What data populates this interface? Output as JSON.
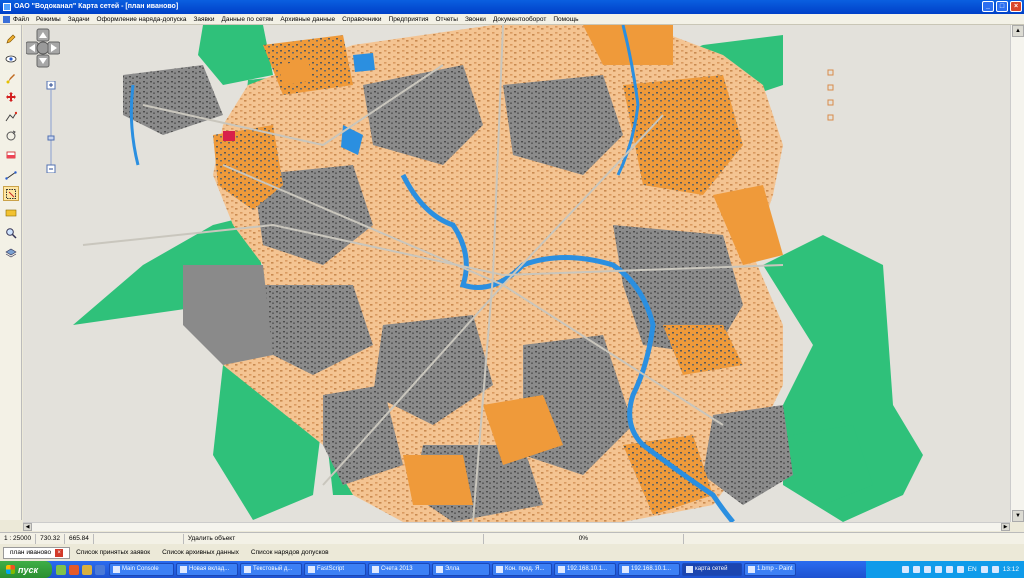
{
  "window": {
    "title": "ОАО \"Водоканал\" Карта сетей - [план иваново]"
  },
  "menu": [
    "Файл",
    "Режимы",
    "Задачи",
    "Оформление наряда-допуска",
    "Заявки",
    "Данные по сетям",
    "Архивные данные",
    "Справочники",
    "Предприятия",
    "Отчеты",
    "Звонки",
    "Документооборот",
    "Помощь"
  ],
  "status": {
    "scale": "1 : 25000",
    "x": "730.32",
    "y": "665.84",
    "message": "Удалить объект",
    "progress": "0%"
  },
  "bottom_tabs": {
    "active": "план иваново",
    "items": [
      "Список принятых заявок",
      "Список архивных данных",
      "Список нарядов допусков"
    ]
  },
  "taskbar": {
    "start": "пуск",
    "tasks": [
      "Main Console",
      "Новая вклад...",
      "Текстовый д...",
      "FastScript",
      "Счета 2013",
      "Элла",
      "Кон. пред. Я...",
      "192.168.10.1...",
      "192.168.10.1...",
      "карта сетей",
      "1.bmp - Paint"
    ],
    "active_task": "карта сетей",
    "lang": "EN",
    "clock": "13:12"
  },
  "colors": {
    "green": "#2fc17a",
    "orange": "#f29b3d",
    "peach": "#f7c896",
    "gray": "#8a8a8a",
    "river": "#2b8fe0",
    "background": "#e3e1db"
  },
  "icons": [
    "pencil-icon",
    "eye-icon",
    "brush-icon",
    "move-icon",
    "route-icon",
    "magnifier-icon",
    "layers-icon"
  ]
}
